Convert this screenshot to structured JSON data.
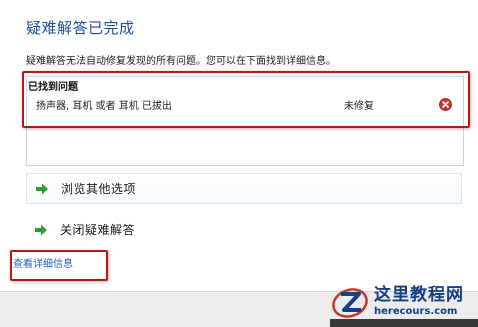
{
  "page": {
    "title": "疑难解答已完成",
    "description": "疑难解答无法自动修复发现的所有问题。您可以在下面找到详细信息。"
  },
  "issues": {
    "header": "已找到问题",
    "rows": [
      {
        "name": "扬声器, 耳机 或者 耳机 已拔出",
        "status": "未修复",
        "icon": "error-icon"
      }
    ]
  },
  "options": {
    "browse_label": "浏览其他选项",
    "close_label": "关闭疑难解答"
  },
  "footer": {
    "details_link": "查看详细信息"
  },
  "watermark": {
    "title": "这里教程网",
    "url": "herecours.com"
  },
  "colors": {
    "title": "#1f4e9a",
    "link": "#1f5dc4",
    "arrow": "#2f9e2f",
    "error": "#c0392b",
    "highlight": "#b21a1a"
  }
}
